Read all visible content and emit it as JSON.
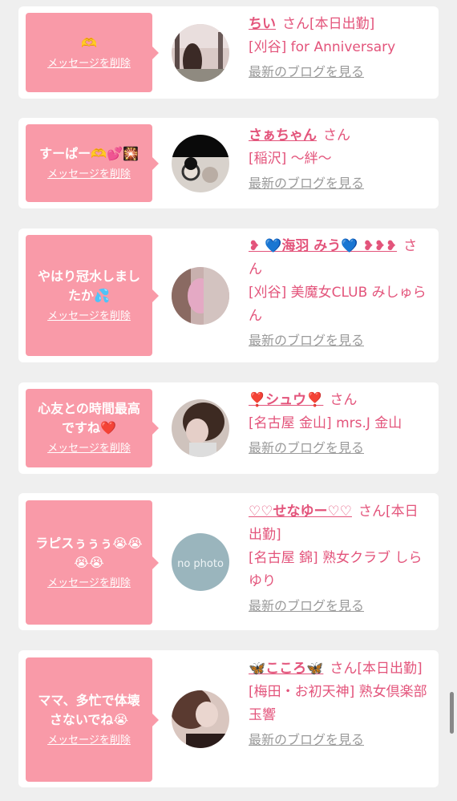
{
  "delete_label": "メッセージを削除",
  "san_label": "さん",
  "blog_label": "最新のブログを見る",
  "entries": [
    {
      "message": "🫶",
      "name": "ちい",
      "name_suffix": "さん[本日出勤]",
      "shop": "[刈谷] for Anniversary"
    },
    {
      "message": "すーぱー🫶💕🎇",
      "name": "さぁちゃん",
      "name_suffix": "さん",
      "shop": "[稲沢] ～絆～"
    },
    {
      "message": "やはり冠水しましたか💦",
      "name": "❥ 💙海羽 みう💙 ❥❥❥",
      "name_suffix": "さん",
      "shop": "[刈谷] 美魔女CLUB みしゅらん"
    },
    {
      "message": "心友との時間最高ですね❤️",
      "name": "❣️シュウ❣️",
      "name_suffix": "さん",
      "shop": "[名古屋 金山] mrs.J 金山"
    },
    {
      "message": "ラピスぅぅぅ😭😭😭😭",
      "name": "♡♡せなゆー♡♡",
      "name_suffix": "さん[本日出勤]",
      "shop": "[名古屋 錦] 熟女クラブ しらゆり",
      "avatar_text": "no photo"
    },
    {
      "message": "ママ、多忙で体壊さないでね😭",
      "name": "🦋こころ🦋",
      "name_suffix": "さん[本日出勤]",
      "shop": "[梅田・お初天神] 熟女倶楽部 玉響"
    }
  ]
}
